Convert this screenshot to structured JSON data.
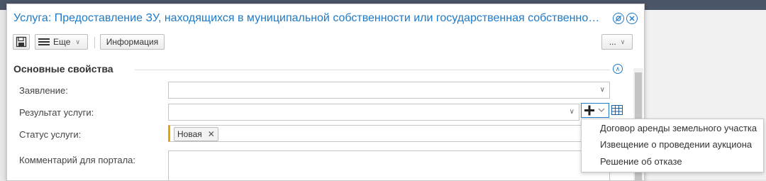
{
  "window": {
    "title": "Услуга: Предоставление ЗУ, находящихся в муниципальной собственности или государственная собственность на к..."
  },
  "toolbar": {
    "more_label": "Еще",
    "info_label": "Информация",
    "overflow_label": "..."
  },
  "section": {
    "title": "Основные свойства"
  },
  "form": {
    "application_label": "Заявление:",
    "result_label": "Результат услуги:",
    "status_label": "Статус услуги:",
    "status_tag": "Новая",
    "comment_label": "Комментарий для портала:"
  },
  "dropdown": {
    "items": [
      "Договор аренды земельного участка",
      "Извещение о проведении аукциона",
      "Решение об отказе"
    ]
  },
  "colors": {
    "accent": "#1f7ac7",
    "required_marker": "#e0a800"
  },
  "icons": [
    "save-icon",
    "hamburger-icon",
    "chevron-down-icon",
    "settings-icon",
    "close-icon",
    "collapse-up-icon",
    "plus-icon",
    "table-icon",
    "tag-remove-icon"
  ]
}
